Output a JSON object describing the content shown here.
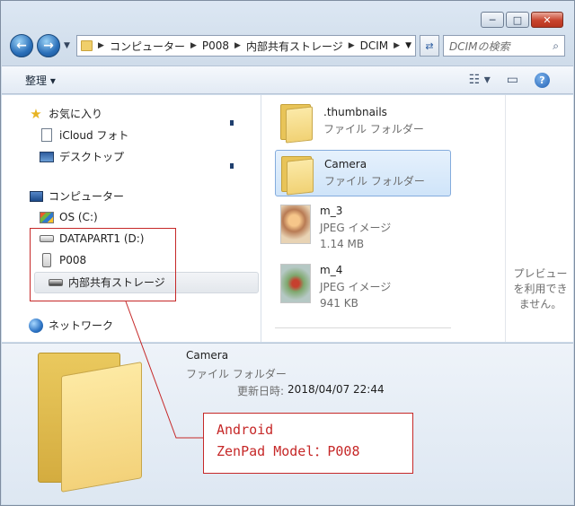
{
  "titlebar": {
    "minimize_glyph": "─",
    "maximize_glyph": "□",
    "close_glyph": "✕"
  },
  "navigation": {
    "back_glyph": "←",
    "forward_glyph": "→",
    "breadcrumbs": [
      "コンピューター",
      "P008",
      "内部共有ストレージ",
      "DCIM"
    ],
    "search_placeholder": "DCIMの検索"
  },
  "toolbar": {
    "organize_label": "整理 ▾",
    "view_glyph": "☷ ▾",
    "preview_glyph": "▭",
    "help_glyph": "?"
  },
  "nav_pane": {
    "favorites": "お気に入り",
    "icloud": "iCloud フォト",
    "desktop": "デスクトップ",
    "computer": "コンピューター",
    "os_drive": "OS (C:)",
    "data_drive": "DATAPART1 (D:)",
    "device": "P008",
    "storage": "内部共有ストレージ",
    "network": "ネットワーク"
  },
  "files": [
    {
      "name": ".thumbnails",
      "type": "ファイル フォルダー",
      "size": ""
    },
    {
      "name": "Camera",
      "type": "ファイル フォルダー",
      "size": ""
    },
    {
      "name": "m_3",
      "type": "JPEG イメージ",
      "size": "1.14 MB"
    },
    {
      "name": "m_4",
      "type": "JPEG イメージ",
      "size": "941 KB"
    }
  ],
  "preview": {
    "message": "プレビューを利用できません。"
  },
  "details": {
    "name": "Camera",
    "type": "ファイル フォルダー",
    "modified_label": "更新日時:",
    "modified_value": "2018/04/07 22:44"
  },
  "annotation": {
    "line1": "Android",
    "line2": "ZenPad Model：P008"
  },
  "colors": {
    "annotation": "#c62828",
    "selection": "#cfe4f9"
  }
}
